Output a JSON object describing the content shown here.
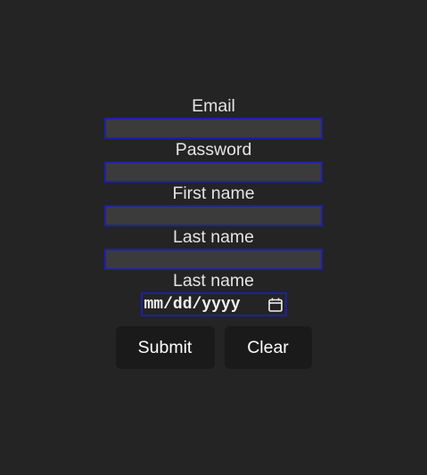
{
  "form": {
    "fields": [
      {
        "label": "Email",
        "value": ""
      },
      {
        "label": "Password",
        "value": ""
      },
      {
        "label": "First name",
        "value": ""
      },
      {
        "label": "Last name",
        "value": ""
      }
    ],
    "date": {
      "label": "Last name",
      "placeholder": "mm/dd/yyyy",
      "icon": "calendar-icon"
    },
    "buttons": {
      "submit": "Submit",
      "clear": "Clear"
    }
  },
  "colors": {
    "background": "#242424",
    "field_bg": "#3b3b3b",
    "field_border": "#1f1fa8",
    "button_bg": "#1a1a1a",
    "text": "#e4e4e4"
  }
}
